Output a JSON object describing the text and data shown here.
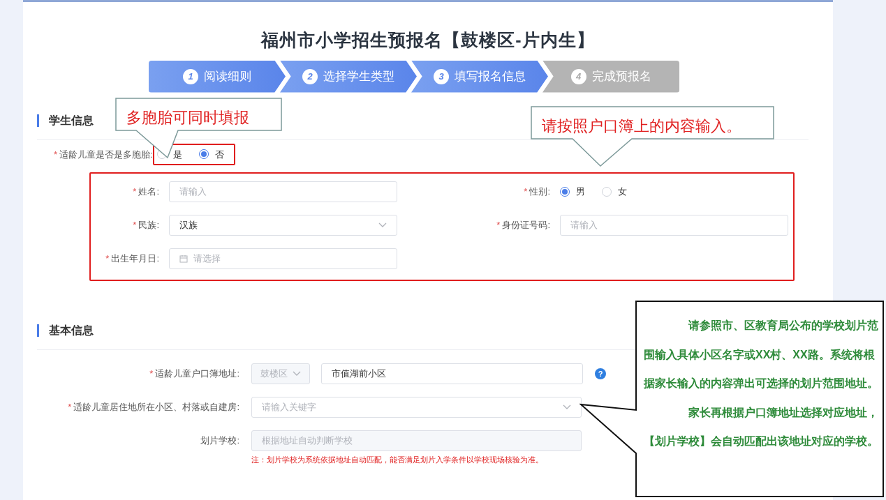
{
  "title": "福州市小学招生预报名【鼓楼区-片内生】",
  "steps": [
    {
      "number": "1",
      "label": "阅读细则",
      "completed": true
    },
    {
      "number": "2",
      "label": "选择学生类型",
      "completed": true
    },
    {
      "number": "3",
      "label": "填写报名信息",
      "completed": true
    },
    {
      "number": "4",
      "label": "完成预报名",
      "completed": false
    }
  ],
  "student_info": {
    "title": "学生信息",
    "multiple_birth": {
      "label": "适龄儿童是否是多胞胎:",
      "marker": "*",
      "options": [
        {
          "label": "是",
          "selected": false
        },
        {
          "label": "否",
          "selected": true
        }
      ]
    },
    "fields": [
      {
        "kind": "input",
        "label": "姓名:",
        "marker": "*",
        "placeholder": "请输入"
      },
      {
        "kind": "radio",
        "label": "性别:",
        "marker": "*",
        "options": [
          {
            "label": "男",
            "selected": true
          },
          {
            "label": "女",
            "selected": false
          }
        ]
      },
      {
        "kind": "select",
        "label": "民族:",
        "marker": "*",
        "value": "汉族"
      },
      {
        "kind": "input",
        "label": "身份证号码:",
        "marker": "*",
        "placeholder": "请输入"
      },
      {
        "kind": "date",
        "label": "出生年月日:",
        "marker": "*",
        "placeholder": "请选择"
      }
    ]
  },
  "basic_info": {
    "title": "基本信息",
    "fields": [
      {
        "kind": "address",
        "label": "适龄儿童户口簿地址:",
        "marker": "*",
        "district": "鼓楼区",
        "value": "市值湖前小区",
        "help": "?"
      },
      {
        "kind": "select",
        "label": "适龄儿童居住地所在小区、村落或自建房:",
        "marker": "*",
        "placeholder": "请输入关键字"
      },
      {
        "kind": "input",
        "label": "划片学校:",
        "disabled": true,
        "placeholder": "根据地址自动判断学校",
        "note": "注：划片学校为系统依据地址自动匹配，能否满足划片入学条件以学校现场核验为准。"
      }
    ]
  },
  "annotations": [
    {
      "kind": "multiple_birth",
      "color": "#e02020",
      "paragraphs": [
        "多胞胎可同时填报"
      ]
    },
    {
      "kind": "fields",
      "color": "#e02020",
      "paragraphs": [
        "请按照户口簿上的内容输入。"
      ]
    },
    {
      "kind": "address",
      "color": "#2e8b3a",
      "paragraphs": [
        "请参照市、区教育局公布的学校划片范围输入具体小区名字或XX村、XX路。系统将根据家长输入的内容弹出可选择的划片范围地址。",
        "家长再根据户口簿地址选择对应地址，【划片学校】会自动匹配出该地址对应的学校。"
      ]
    }
  ]
}
